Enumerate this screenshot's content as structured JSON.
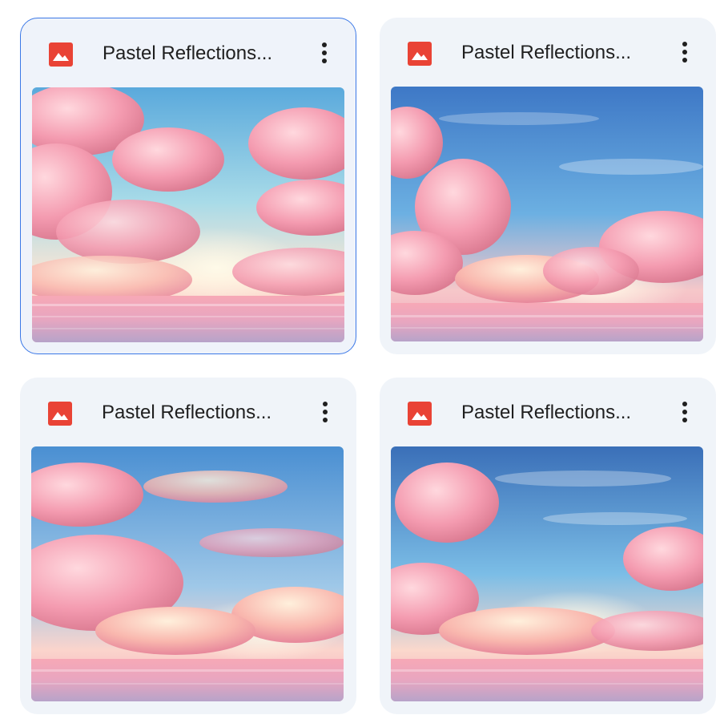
{
  "files": [
    {
      "title": "Pastel Reflections...",
      "icon": "image-file-icon",
      "selected": true
    },
    {
      "title": "Pastel Reflections...",
      "icon": "image-file-icon",
      "selected": false
    },
    {
      "title": "Pastel Reflections...",
      "icon": "image-file-icon",
      "selected": false
    },
    {
      "title": "Pastel Reflections...",
      "icon": "image-file-icon",
      "selected": false
    }
  ],
  "colors": {
    "card_bg": "#f0f4f9",
    "selected_border": "#3b78e7",
    "icon_red": "#e94335",
    "title_text": "#1f1f1f"
  }
}
